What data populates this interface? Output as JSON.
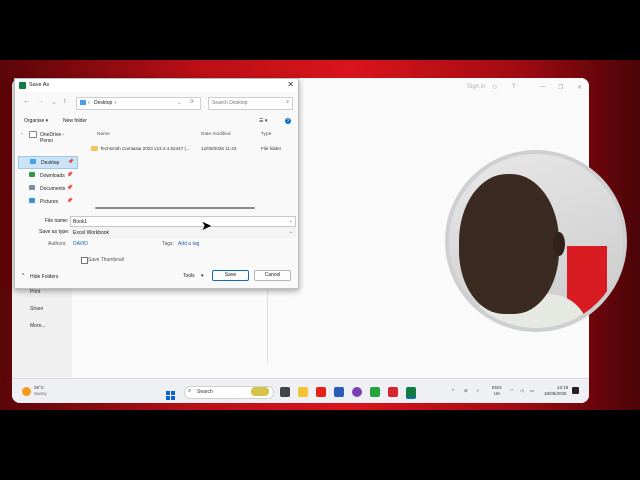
{
  "dialog": {
    "title": "Save As",
    "close_glyph": "✕",
    "nav": {
      "back": "←",
      "forward": "→",
      "dropdown": "⌄",
      "up": "↑",
      "refresh": "⟳"
    },
    "breadcrumb": {
      "location": "Desktop",
      "separator": "›",
      "chevron": "›"
    },
    "search_placeholder": "Search Desktop",
    "commands": {
      "organise": "Organise ▾",
      "new_folder": "New folder",
      "view": "☰ ▾",
      "help": "?"
    },
    "sidebar": [
      {
        "label": "OneDrive - Perso",
        "icon": "onedrive-icon",
        "pin": ""
      },
      {
        "label": "Desktop",
        "icon": "desktop-folder-icon",
        "pin": "📌"
      },
      {
        "label": "Downloads",
        "icon": "downloads-icon",
        "pin": "📌"
      },
      {
        "label": "Documents",
        "icon": "documents-icon",
        "pin": "📌"
      },
      {
        "label": "Pictures",
        "icon": "pictures-icon",
        "pin": "📌"
      }
    ],
    "columns": {
      "name": "Name",
      "date": "Date modified",
      "type": "Type"
    },
    "rows": [
      {
        "name": "Techsmith Camtasia 2023 v23.4.4.52447 (...",
        "date": "12/09/2026 11:43",
        "type": "File folder"
      }
    ],
    "file_name_label": "File name:",
    "file_name_value": "Book1",
    "save_as_type_label": "Save as type:",
    "save_as_type_value": "Excel Workbook",
    "authors_label": "Authors:",
    "authors_value": "DAVID",
    "tags_label": "Tags:",
    "tags_value": "Add a tag",
    "thumbnail_label": "Save Thumbnail",
    "hide_folders": "Hide Folders",
    "tools": "Tools",
    "save": "Save",
    "cancel": "Cancel"
  },
  "backstage": {
    "left_items": [
      "Print",
      "Share",
      "More..."
    ],
    "sign_in": "Sign in"
  },
  "taskbar": {
    "weather_temp": "26°C",
    "weather_desc": "Sunny",
    "search_label": "Search",
    "lang_top": "ENG",
    "lang_bottom": "UK",
    "time": "13:19",
    "date": "18/09/2026"
  },
  "colors": {
    "accent": "#0f6cbd",
    "brand_red": "#d9141c",
    "excel_green": "#107c41"
  }
}
